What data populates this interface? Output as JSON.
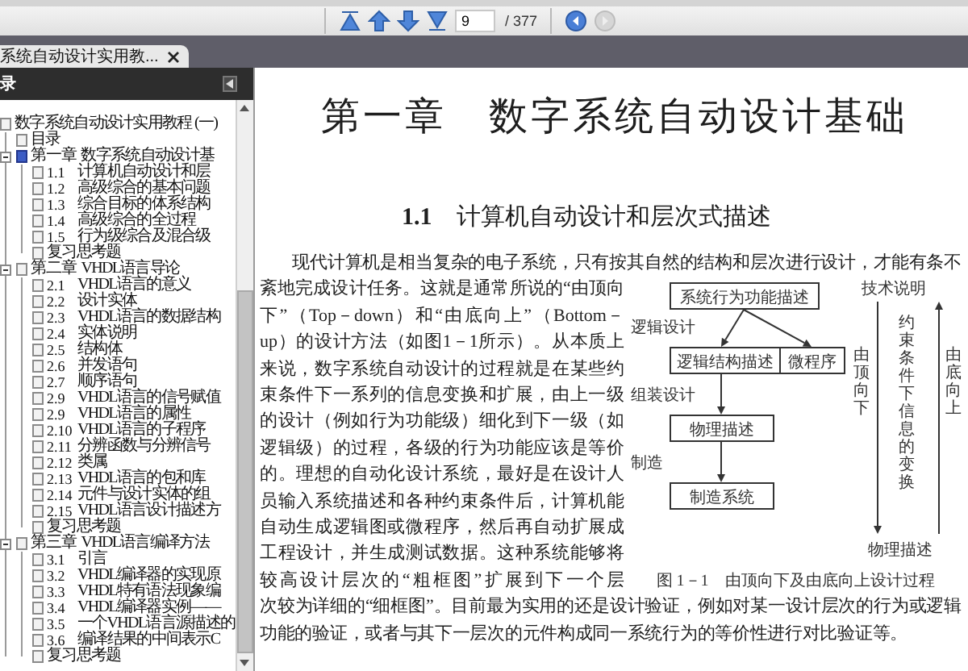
{
  "toolbar": {
    "nav_buttons": [
      {
        "kind": "first",
        "disabled": false
      },
      {
        "kind": "previous",
        "disabled": false
      },
      {
        "kind": "next",
        "disabled": false
      },
      {
        "kind": "last",
        "disabled": false
      }
    ],
    "page_field": {
      "value": "9"
    },
    "page_count": "/ 377",
    "history_buttons": [
      {
        "kind": "back",
        "disabled": false
      },
      {
        "kind": "forward",
        "disabled": true
      }
    ]
  },
  "tabs": [
    {
      "label": "系统自动设计实用教...",
      "selected": true
    }
  ],
  "sidebar": {
    "title": "录",
    "tree": [
      {
        "title": "数字系统自动设计实用教程 (一)",
        "selected": false,
        "children": [
          {
            "title": "目录",
            "selected": false
          },
          {
            "number": "第一章",
            "title": "数字系统自动设计基",
            "selected": true,
            "expanded": true,
            "children": [
              {
                "number": "1.1",
                "title": "计算机自动设计和层",
                "selected": false
              },
              {
                "number": "1.2",
                "title": "高级综合的基本问题",
                "selected": false
              },
              {
                "number": "1.3",
                "title": "综合目标的体系结构",
                "selected": false
              },
              {
                "number": "1.4",
                "title": "高级综合的全过程",
                "selected": false
              },
              {
                "number": "1.5",
                "title": "行为级综合及混合级",
                "selected": false
              },
              {
                "title": "复习思考题",
                "selected": false
              }
            ]
          },
          {
            "number": "第二章",
            "title": "VHDL语言导论",
            "selected": false,
            "expanded": true,
            "children": [
              {
                "number": "2.1",
                "title": "VHDL语言的意义",
                "selected": false
              },
              {
                "number": "2.2",
                "title": "设计实体",
                "selected": false
              },
              {
                "number": "2.3",
                "title": "VHDL语言的数据结构",
                "selected": false
              },
              {
                "number": "2.4",
                "title": "实体说明",
                "selected": false
              },
              {
                "number": "2.5",
                "title": "结构体",
                "selected": false
              },
              {
                "number": "2.6",
                "title": "并发语句",
                "selected": false
              },
              {
                "number": "2.7",
                "title": "顺序语句",
                "selected": false
              },
              {
                "number": "2.9",
                "title": "VHDL语言的信号赋值",
                "selected": false
              },
              {
                "number": "2.9",
                "title": "VHDL语言的属性",
                "selected": false
              },
              {
                "number": "2.10",
                "title": "VHDL语言的子程序",
                "selected": false
              },
              {
                "number": "2.11",
                "title": "分辨函数与分辨信号",
                "selected": false
              },
              {
                "number": "2.12",
                "title": "类属",
                "selected": false
              },
              {
                "number": "2.13",
                "title": "VHDL语言的包和库",
                "selected": false
              },
              {
                "number": "2.14",
                "title": "元件与设计实体的组",
                "selected": false
              },
              {
                "number": "2.15",
                "title": "VHDL语言设计描述方",
                "selected": false
              },
              {
                "title": "复习思考题",
                "selected": false
              }
            ]
          },
          {
            "number": "第三章",
            "title": "VHDL语言编译方法",
            "selected": false,
            "expanded": true,
            "children": [
              {
                "number": "3.1",
                "title": "引言",
                "selected": false
              },
              {
                "number": "3.2",
                "title": "VHDL编译器的实现原",
                "selected": false
              },
              {
                "number": "3.3",
                "title": "VHDL特有语法现象编",
                "selected": false
              },
              {
                "number": "3.4",
                "title": "VHDL编译器实例——",
                "selected": false
              },
              {
                "number": "3.5",
                "title": "一个VHDL语言源描述的",
                "selected": false
              },
              {
                "number": "3.6",
                "title": "编译结果的中间表示C",
                "selected": false
              },
              {
                "title": "复习思考题",
                "selected": false
              }
            ]
          }
        ]
      }
    ]
  },
  "document": {
    "chapter_heading": "第一章　数字系统自动设计基础",
    "section_heading": "**1.1**　计算机自动设计和层次式描述",
    "paragraph_parts": [
      "现代计算机是相当复杂的电子系统，只有按其自然的结构和层次进行设计，才能有条不",
      "紊地完成设计任务。这就是通常所说的“由顶向下”（Top－down）和“由底向上”（Bottom－up）的设计方法（如图1－1所示）。从本质上来说，数字系统自动设计的过程就是在某些约束条件下一系列的信息变换和扩展，由上一级的设计（例如行为功能级）细化到下一级（如逻辑级）的过程，各级的行为功能应该是等价的。理想的自动化设计系统，最好是在设计人员输入系统描述和各种约束条件后，计算机能自动生成逻辑图或微程序，然后再自动扩展成工程设计，并生成测试数据。这种系统能够将较高设计层次的“粗框图”扩展到下一个层",
      "次较为详细的“细框图”。目前最为实用的还是设计验证，例如对某一设计层次的行为或逻辑功能的验证，或者与其下一层次的元件构成同一系统行为的等价性进行对比验证等。"
    ],
    "figure": {
      "top_box": "系统行为功能描述",
      "split_box": [
        "逻辑结构描述",
        "微程序"
      ],
      "boxes": [
        "物理描述",
        "制造系统"
      ],
      "stage_labels": [
        "逻辑设计",
        "组装设计",
        "制造"
      ],
      "top_label": "技术说明",
      "down_label": "由顶向下",
      "middle_label": "约束条件下信息的变换",
      "up_label": "由底向上",
      "bottom_label": "物理描述",
      "caption": "图 1－1　由顶向下及由底向上设计过程"
    }
  }
}
